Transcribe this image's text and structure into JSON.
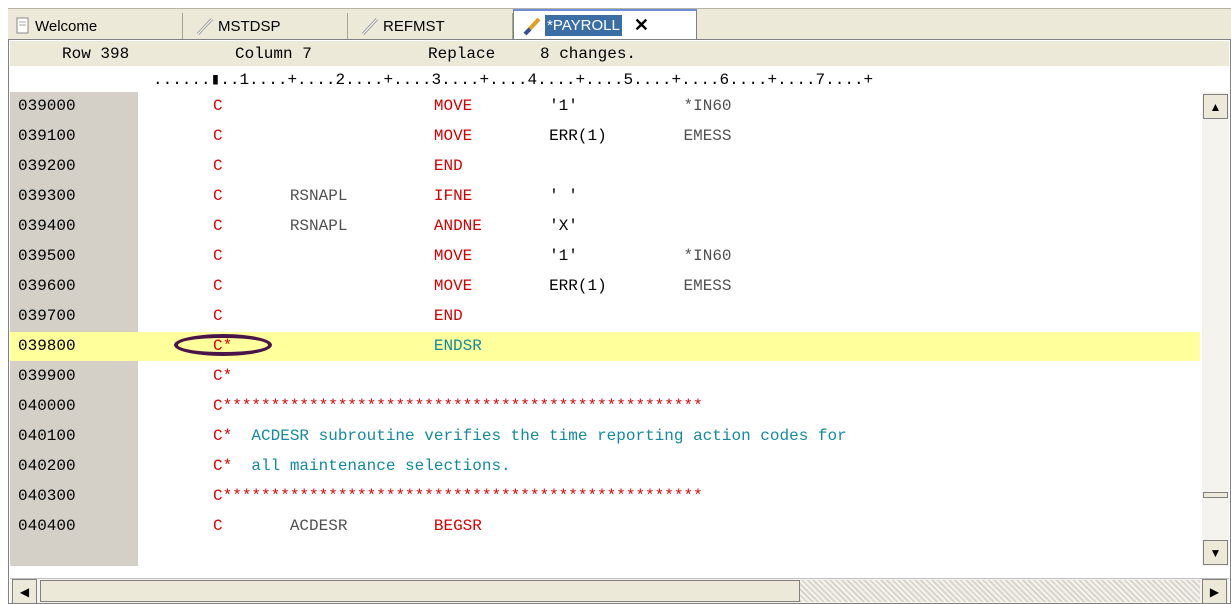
{
  "tabs": [
    {
      "label": "Welcome",
      "icon": "document-icon"
    },
    {
      "label": "MSTDSP",
      "icon": "pencil-icon"
    },
    {
      "label": "REFMST",
      "icon": "pencil-icon"
    },
    {
      "label": "*PAYROLL",
      "icon": "pencil-icon",
      "active": true,
      "close": "✕"
    }
  ],
  "status": {
    "row": "Row 398",
    "column": "Column 7",
    "mode": "Replace",
    "changes": "8 changes."
  },
  "ruler": "......▮..1....+....2....+....3....+....4....+....5....+....6....+....7....+",
  "lines": [
    {
      "seq": "039000",
      "spec": "C",
      "factor1": "",
      "opcode": "MOVE",
      "factor2": "'1'",
      "result": "*IN60"
    },
    {
      "seq": "039100",
      "spec": "C",
      "factor1": "",
      "opcode": "MOVE",
      "factor2": "ERR(1)",
      "result": "EMESS"
    },
    {
      "seq": "039200",
      "spec": "C",
      "factor1": "",
      "opcode": "END",
      "factor2": "",
      "result": ""
    },
    {
      "seq": "039300",
      "spec": "C",
      "factor1": "RSNAPL",
      "opcode": "IFNE",
      "factor2": "' '",
      "result": ""
    },
    {
      "seq": "039400",
      "spec": "C",
      "factor1": "RSNAPL",
      "opcode": "ANDNE",
      "factor2": "'X'",
      "result": ""
    },
    {
      "seq": "039500",
      "spec": "C",
      "factor1": "",
      "opcode": "MOVE",
      "factor2": "'1'",
      "result": "*IN60"
    },
    {
      "seq": "039600",
      "spec": "C",
      "factor1": "",
      "opcode": "MOVE",
      "factor2": "ERR(1)",
      "result": "EMESS"
    },
    {
      "seq": "039700",
      "spec": "C",
      "factor1": "",
      "opcode": "END",
      "factor2": "",
      "result": ""
    },
    {
      "seq": "039800",
      "spec": "C*",
      "factor1": "",
      "opcode": "ENDSR",
      "factor2": "",
      "result": "",
      "highlight": true
    },
    {
      "seq": "039900",
      "spec": "C*",
      "comment": ""
    },
    {
      "seq": "040000",
      "spec": "C",
      "comment": "**************************************************"
    },
    {
      "seq": "040100",
      "spec": "C*",
      "comment": "  ACDESR subroutine verifies the time reporting action codes for"
    },
    {
      "seq": "040200",
      "spec": "C*",
      "comment": "  all maintenance selections."
    },
    {
      "seq": "040300",
      "spec": "C",
      "comment": "**************************************************"
    },
    {
      "seq": "040400",
      "spec": "C",
      "factor1": "ACDESR",
      "opcode": "BEGSR",
      "factor2": "",
      "result": ""
    }
  ],
  "colors": {
    "spec": "#d40000",
    "opcode": "#d40000",
    "comment": "#138aa0",
    "highlight": "#ffff9c",
    "annotation": "#4b1448"
  },
  "scroll": {
    "up": "▲",
    "down": "▼",
    "left": "◀",
    "right": "▶"
  }
}
